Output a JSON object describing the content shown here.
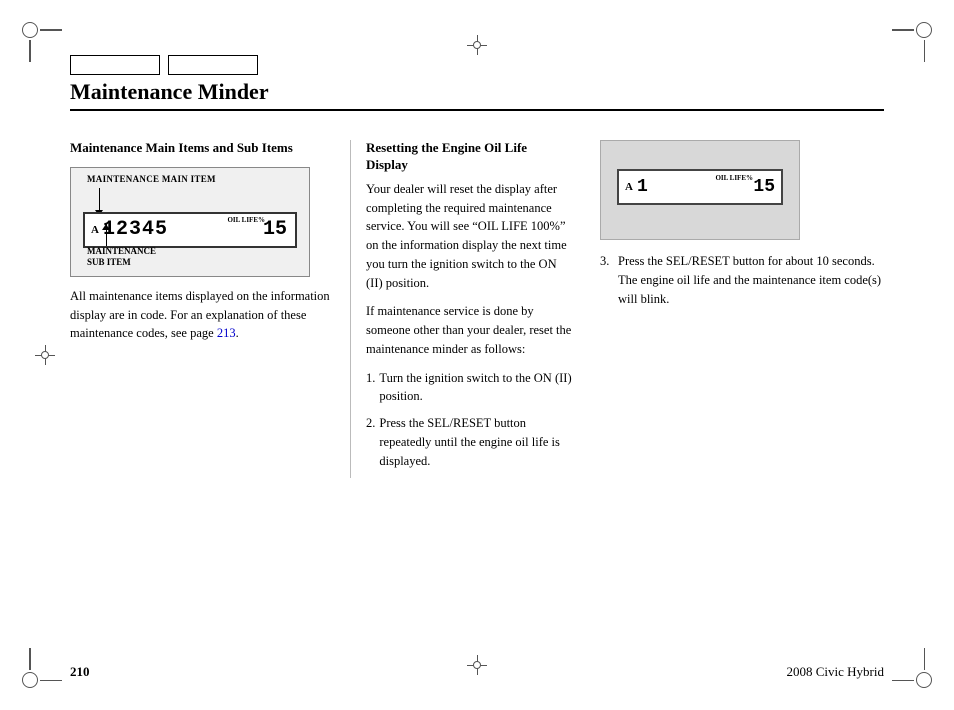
{
  "header": {
    "title": "Maintenance Minder",
    "boxes": [
      "",
      ""
    ]
  },
  "left_section": {
    "title": "Maintenance Main Items and Sub Items",
    "diagram": {
      "top_label": "MAINTENANCE MAIN ITEM",
      "display_a": "A",
      "display_numbers": "12345",
      "oil_label": "OIL LIFE%",
      "display_15": "15",
      "bottom_label_line1": "MAINTENANCE",
      "bottom_label_line2": "SUB ITEM"
    },
    "body_text": "All maintenance items displayed on the information display are in code. For an explanation of these maintenance codes, see page ",
    "link_text": "213",
    "body_text_end": "."
  },
  "mid_section": {
    "title_line1": "Resetting the Engine Oil Life",
    "title_line2": "Display",
    "para1": "Your dealer will reset the display after completing the required maintenance service. You will see “OIL LIFE 100%” on the information display the next time you turn the ignition switch to the ON (II) position.",
    "para2": "If maintenance service is done by someone other than your dealer, reset the maintenance minder as follows:",
    "step1_num": "1.",
    "step1_text": "Turn the ignition switch to the ON (II) position.",
    "step2_num": "2.",
    "step2_text": "Press the SEL/RESET button repeatedly until the engine oil life is displayed."
  },
  "right_section": {
    "display_a": "A",
    "display_1": "1",
    "oil_label": "OIL LIFE%",
    "display_15": "15",
    "step3_num": "3.",
    "step3_text": "Press the SEL/RESET button for about 10 seconds. The engine oil life and the maintenance item code(s) will blink."
  },
  "footer": {
    "page_number": "210",
    "title": "2008  Civic  Hybrid"
  }
}
